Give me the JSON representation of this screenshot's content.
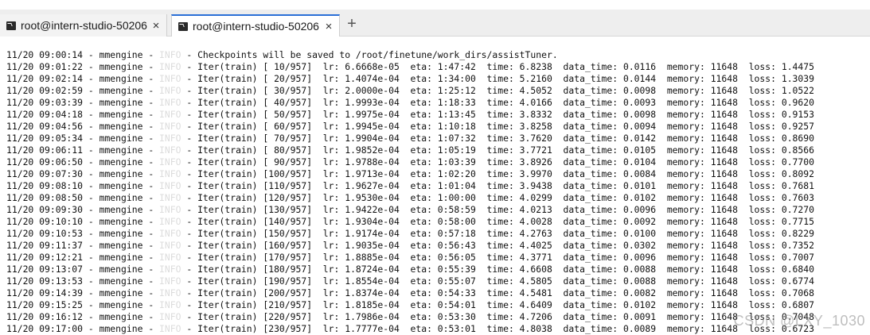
{
  "tabs": [
    {
      "title": "root@intern-studio-50206",
      "active": false
    },
    {
      "title": "root@intern-studio-50206",
      "active": true
    }
  ],
  "new_tab_label": "+",
  "close_label": "×",
  "log_level": "INFO",
  "log_lines": [
    {
      "ts": "11/20 09:00:14",
      "logger": "mmengine",
      "msg": "Checkpoints will be saved to /root/finetune/work_dirs/assistTuner."
    },
    {
      "ts": "11/20 09:01:22",
      "logger": "mmengine",
      "msg": "Iter(train) [ 10/957]  lr: 6.6668e-05  eta: 1:47:42  time: 6.8238  data_time: 0.0116  memory: 11648  loss: 1.4475"
    },
    {
      "ts": "11/20 09:02:14",
      "logger": "mmengine",
      "msg": "Iter(train) [ 20/957]  lr: 1.4074e-04  eta: 1:34:00  time: 5.2160  data_time: 0.0144  memory: 11648  loss: 1.3039"
    },
    {
      "ts": "11/20 09:02:59",
      "logger": "mmengine",
      "msg": "Iter(train) [ 30/957]  lr: 2.0000e-04  eta: 1:25:12  time: 4.5052  data_time: 0.0098  memory: 11648  loss: 1.0522"
    },
    {
      "ts": "11/20 09:03:39",
      "logger": "mmengine",
      "msg": "Iter(train) [ 40/957]  lr: 1.9993e-04  eta: 1:18:33  time: 4.0166  data_time: 0.0093  memory: 11648  loss: 0.9620"
    },
    {
      "ts": "11/20 09:04:18",
      "logger": "mmengine",
      "msg": "Iter(train) [ 50/957]  lr: 1.9975e-04  eta: 1:13:45  time: 3.8332  data_time: 0.0098  memory: 11648  loss: 0.9153"
    },
    {
      "ts": "11/20 09:04:56",
      "logger": "mmengine",
      "msg": "Iter(train) [ 60/957]  lr: 1.9945e-04  eta: 1:10:18  time: 3.8258  data_time: 0.0094  memory: 11648  loss: 0.9257"
    },
    {
      "ts": "11/20 09:05:34",
      "logger": "mmengine",
      "msg": "Iter(train) [ 70/957]  lr: 1.9904e-04  eta: 1:07:32  time: 3.7620  data_time: 0.0142  memory: 11648  loss: 0.8690"
    },
    {
      "ts": "11/20 09:06:11",
      "logger": "mmengine",
      "msg": "Iter(train) [ 80/957]  lr: 1.9852e-04  eta: 1:05:19  time: 3.7721  data_time: 0.0105  memory: 11648  loss: 0.8566"
    },
    {
      "ts": "11/20 09:06:50",
      "logger": "mmengine",
      "msg": "Iter(train) [ 90/957]  lr: 1.9788e-04  eta: 1:03:39  time: 3.8926  data_time: 0.0104  memory: 11648  loss: 0.7700"
    },
    {
      "ts": "11/20 09:07:30",
      "logger": "mmengine",
      "msg": "Iter(train) [100/957]  lr: 1.9713e-04  eta: 1:02:20  time: 3.9970  data_time: 0.0084  memory: 11648  loss: 0.8092"
    },
    {
      "ts": "11/20 09:08:10",
      "logger": "mmengine",
      "msg": "Iter(train) [110/957]  lr: 1.9627e-04  eta: 1:01:04  time: 3.9438  data_time: 0.0101  memory: 11648  loss: 0.7681"
    },
    {
      "ts": "11/20 09:08:50",
      "logger": "mmengine",
      "msg": "Iter(train) [120/957]  lr: 1.9530e-04  eta: 1:00:00  time: 4.0299  data_time: 0.0102  memory: 11648  loss: 0.7603"
    },
    {
      "ts": "11/20 09:09:30",
      "logger": "mmengine",
      "msg": "Iter(train) [130/957]  lr: 1.9422e-04  eta: 0:58:59  time: 4.0213  data_time: 0.0096  memory: 11648  loss: 0.7270"
    },
    {
      "ts": "11/20 09:10:10",
      "logger": "mmengine",
      "msg": "Iter(train) [140/957]  lr: 1.9304e-04  eta: 0:58:00  time: 4.0028  data_time: 0.0092  memory: 11648  loss: 0.7715"
    },
    {
      "ts": "11/20 09:10:53",
      "logger": "mmengine",
      "msg": "Iter(train) [150/957]  lr: 1.9174e-04  eta: 0:57:18  time: 4.2763  data_time: 0.0100  memory: 11648  loss: 0.8229"
    },
    {
      "ts": "11/20 09:11:37",
      "logger": "mmengine",
      "msg": "Iter(train) [160/957]  lr: 1.9035e-04  eta: 0:56:43  time: 4.4025  data_time: 0.0302  memory: 11648  loss: 0.7352"
    },
    {
      "ts": "11/20 09:12:21",
      "logger": "mmengine",
      "msg": "Iter(train) [170/957]  lr: 1.8885e-04  eta: 0:56:05  time: 4.3771  data_time: 0.0096  memory: 11648  loss: 0.7007"
    },
    {
      "ts": "11/20 09:13:07",
      "logger": "mmengine",
      "msg": "Iter(train) [180/957]  lr: 1.8724e-04  eta: 0:55:39  time: 4.6608  data_time: 0.0088  memory: 11648  loss: 0.6840"
    },
    {
      "ts": "11/20 09:13:53",
      "logger": "mmengine",
      "msg": "Iter(train) [190/957]  lr: 1.8554e-04  eta: 0:55:07  time: 4.5805  data_time: 0.0088  memory: 11648  loss: 0.6774"
    },
    {
      "ts": "11/20 09:14:39",
      "logger": "mmengine",
      "msg": "Iter(train) [200/957]  lr: 1.8374e-04  eta: 0:54:33  time: 4.5481  data_time: 0.0082  memory: 11648  loss: 0.7068"
    },
    {
      "ts": "11/20 09:15:25",
      "logger": "mmengine",
      "msg": "Iter(train) [210/957]  lr: 1.8185e-04  eta: 0:54:01  time: 4.6409  data_time: 0.0102  memory: 11648  loss: 0.6807"
    },
    {
      "ts": "11/20 09:16:12",
      "logger": "mmengine",
      "msg": "Iter(train) [220/957]  lr: 1.7986e-04  eta: 0:53:30  time: 4.7206  data_time: 0.0091  memory: 11648  loss: 0.7048"
    },
    {
      "ts": "11/20 09:17:00",
      "logger": "mmengine",
      "msg": "Iter(train) [230/957]  lr: 1.7777e-04  eta: 0:53:01  time: 4.8038  data_time: 0.0089  memory: 11648  loss: 0.6723"
    }
  ],
  "watermark": "CSDN @LXY_1030"
}
